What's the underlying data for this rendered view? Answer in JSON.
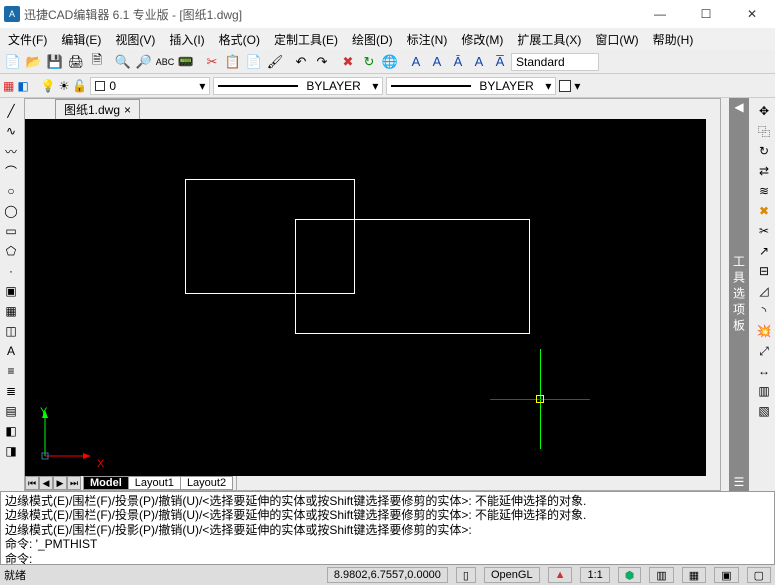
{
  "title": "迅捷CAD编辑器 6.1 专业版  -  [图纸1.dwg]",
  "menu": [
    "文件(F)",
    "编辑(E)",
    "视图(V)",
    "插入(I)",
    "格式(O)",
    "定制工具(E)",
    "绘图(D)",
    "标注(N)",
    "修改(M)",
    "扩展工具(X)",
    "窗口(W)",
    "帮助(H)"
  ],
  "text_style": "Standard",
  "layer_value": "0",
  "linetype": "BYLAYER",
  "lineweight": "BYLAYER",
  "tab": {
    "name": "图纸1.dwg",
    "close": "×"
  },
  "ucs": {
    "y": "Y",
    "x": "X"
  },
  "layout_tabs": [
    "Model",
    "Layout1",
    "Layout2"
  ],
  "cmd_lines": [
    "边缘模式(E)/围栏(F)/投景(P)/撤销(U)/<选择要延伸的实体或按Shift键选择要修剪的实体>: 不能延伸选择的对象.",
    "边缘模式(E)/围栏(F)/投景(P)/撤销(U)/<选择要延伸的实体或按Shift键选择要修剪的实体>: 不能延伸选择的对象.",
    "边缘模式(E)/围栏(F)/投影(P)/撤销(U)/<选择要延伸的实体或按Shift键选择要修剪的实体>:",
    "命令: '_PMTHIST",
    "命令:"
  ],
  "status": {
    "ready": "就绪",
    "coords": "8.9802,6.7557,0.0000",
    "renderer": "OpenGL",
    "ratio": "1:1"
  },
  "right_panel": "工具选项板"
}
